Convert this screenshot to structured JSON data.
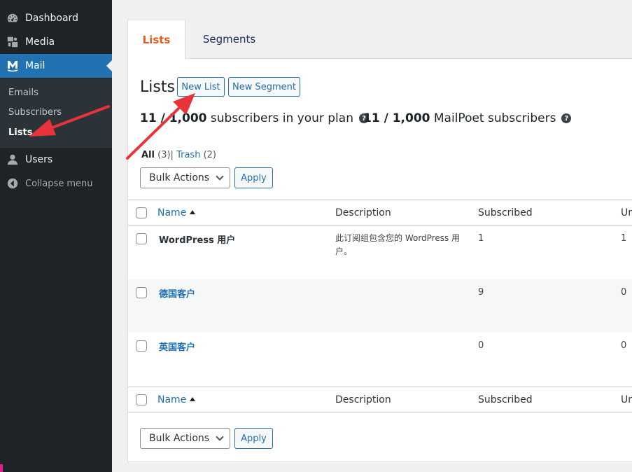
{
  "sidebar": {
    "items": [
      {
        "label": "Dashboard",
        "icon": "dashboard-icon"
      },
      {
        "label": "Media",
        "icon": "media-icon"
      },
      {
        "label": "Mail",
        "icon": "mailpoet-icon"
      }
    ],
    "submenu": [
      "Emails",
      "Subscribers",
      "Lists"
    ],
    "users_label": "Users",
    "collapse_label": "Collapse menu"
  },
  "tabs": {
    "lists": "Lists",
    "segments": "Segments"
  },
  "page": {
    "title": "Lists",
    "new_list": "New List",
    "new_segment": "New Segment"
  },
  "plan": {
    "plan_count": "11 / 1,000",
    "plan_text": "subscribers in your plan",
    "mp_count": "11 / 1,000",
    "mp_text": "MailPoet subscribers",
    "help": "?"
  },
  "filters": {
    "all": "All",
    "all_count": "(3)",
    "sep": "|",
    "trash": "Trash",
    "trash_count": "(2)"
  },
  "bulk": {
    "label": "Bulk Actions",
    "apply": "Apply"
  },
  "table": {
    "headers": {
      "name": "Name",
      "description": "Description",
      "subscribed": "Subscribed",
      "unsubscribed": "Un"
    },
    "rows": [
      {
        "name": "WordPress 用户",
        "description": "此订阅组包含您的 WordPress 用户。",
        "subscribed": "1",
        "unsubscribed": "1"
      },
      {
        "name": "德国客户",
        "description": "",
        "subscribed": "9",
        "unsubscribed": "0"
      },
      {
        "name": "英国客户",
        "description": "",
        "subscribed": "0",
        "unsubscribed": "0"
      }
    ]
  },
  "colors": {
    "sidebar": "#1d2327",
    "accent": "#2271b1",
    "active_tab": "#e35b20",
    "annotation": "#e8333a"
  }
}
